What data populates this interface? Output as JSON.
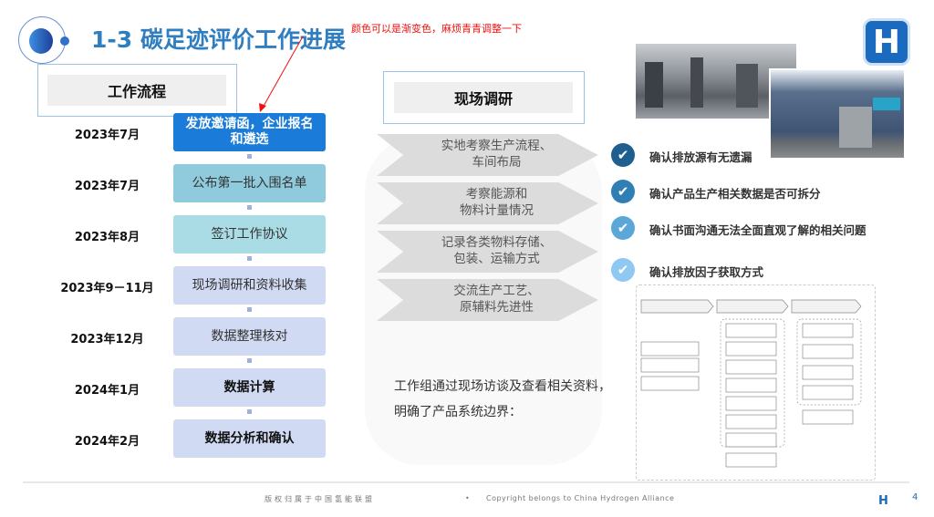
{
  "header": {
    "title": "1-3 碳足迹评价工作进展",
    "annotation": "颜色可以是渐变色，麻烦青青调整一下",
    "brand_logo": "H",
    "accent": "#2f7ec0"
  },
  "left": {
    "heading": "工作流程",
    "steps": [
      {
        "date": "2023年7月",
        "label": "发放邀请函，企业报名和遴选",
        "color": "#1a7bd8"
      },
      {
        "date": "2023年7月",
        "label": "公布第一批入围名单",
        "color": "#8fcbdc"
      },
      {
        "date": "2023年8月",
        "label": "签订工作协议",
        "color": "#aadce6"
      },
      {
        "date": "2023年9－11月",
        "label": "现场调研和资料收集",
        "color": "#d0daf2"
      },
      {
        "date": "2023年12月",
        "label": "数据整理核对",
        "color": "#d0daf2"
      },
      {
        "date": "2024年1月",
        "label": "数据计算",
        "color": "#d0daf2"
      },
      {
        "date": "2024年2月",
        "label": "数据分析和确认",
        "color": "#d0daf2"
      }
    ]
  },
  "middle": {
    "heading": "现场调研",
    "chevrons": [
      "实地考察生产流程、\n车间布局",
      "考察能源和\n物料计量情况",
      "记录各类物料存储、\n包装、运输方式",
      "交流生产工艺、\n原辅料先进性"
    ],
    "summary_line1": "工作组通过现场访谈及查看相关资料，",
    "summary_line2": "明确了产品系统边界："
  },
  "right": {
    "checks": [
      {
        "label": "确认排放源有无遗漏",
        "color": "#1f5f8f"
      },
      {
        "label": "确认产品生产相关数据是否可拆分",
        "color": "#2f7fb5"
      },
      {
        "label": "确认书面沟通无法全面直观了解的相关问题",
        "color": "#5aa7d8"
      },
      {
        "label": "确认排放因子获取方式",
        "color": "#8fc8f0"
      }
    ]
  },
  "footer": {
    "copyright_cn": "版权归属于中国氢能联盟",
    "bullet": "•",
    "copyright_en": "Copyright belongs to China Hydrogen Alliance",
    "logo": "H",
    "page": "4"
  }
}
